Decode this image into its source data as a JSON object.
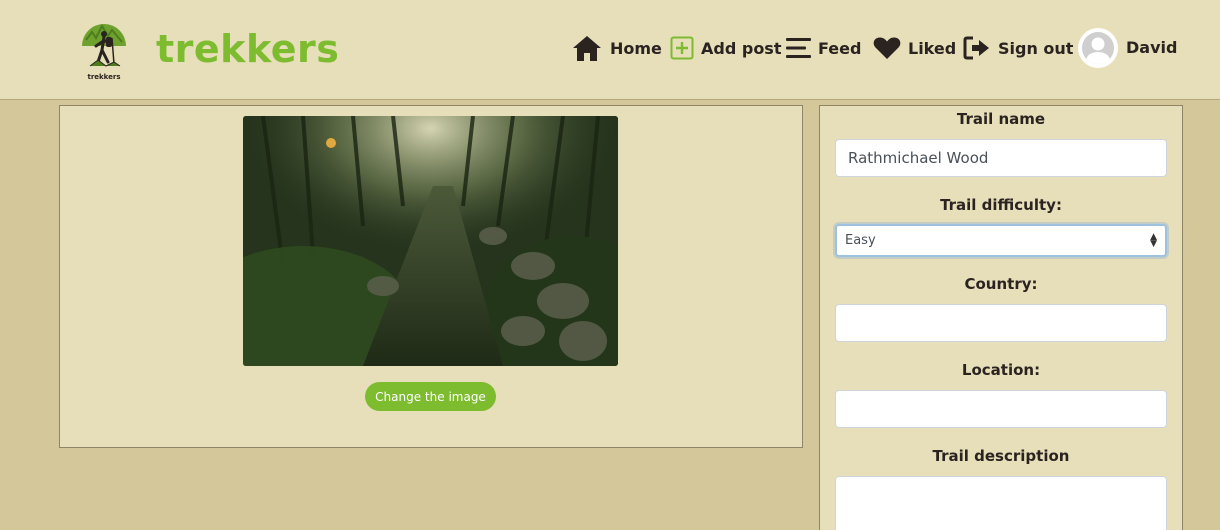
{
  "brand": {
    "logo_text": "trekkers",
    "name": "trekkers"
  },
  "nav": {
    "home": "Home",
    "add_post": "Add post",
    "feed": "Feed",
    "liked": "Liked",
    "sign_out": "Sign out",
    "username": "David"
  },
  "image_panel": {
    "change_button": "Change the image"
  },
  "form": {
    "trail_name_label": "Trail name",
    "trail_name_value": "Rathmichael Wood",
    "difficulty_label": "Trail difficulty:",
    "difficulty_value": "Easy",
    "country_label": "Country:",
    "country_value": "",
    "location_label": "Location:",
    "location_value": "",
    "description_label": "Trail description",
    "description_value": ""
  },
  "colors": {
    "accent": "#7dbb2f",
    "navbar_bg": "#e6dfb9",
    "page_bg": "#d4c79a",
    "text": "#2b2320"
  },
  "icons": [
    "home-icon",
    "plus-square-icon",
    "bars-icon",
    "heart-icon",
    "sign-out-icon",
    "user-avatar-icon"
  ]
}
